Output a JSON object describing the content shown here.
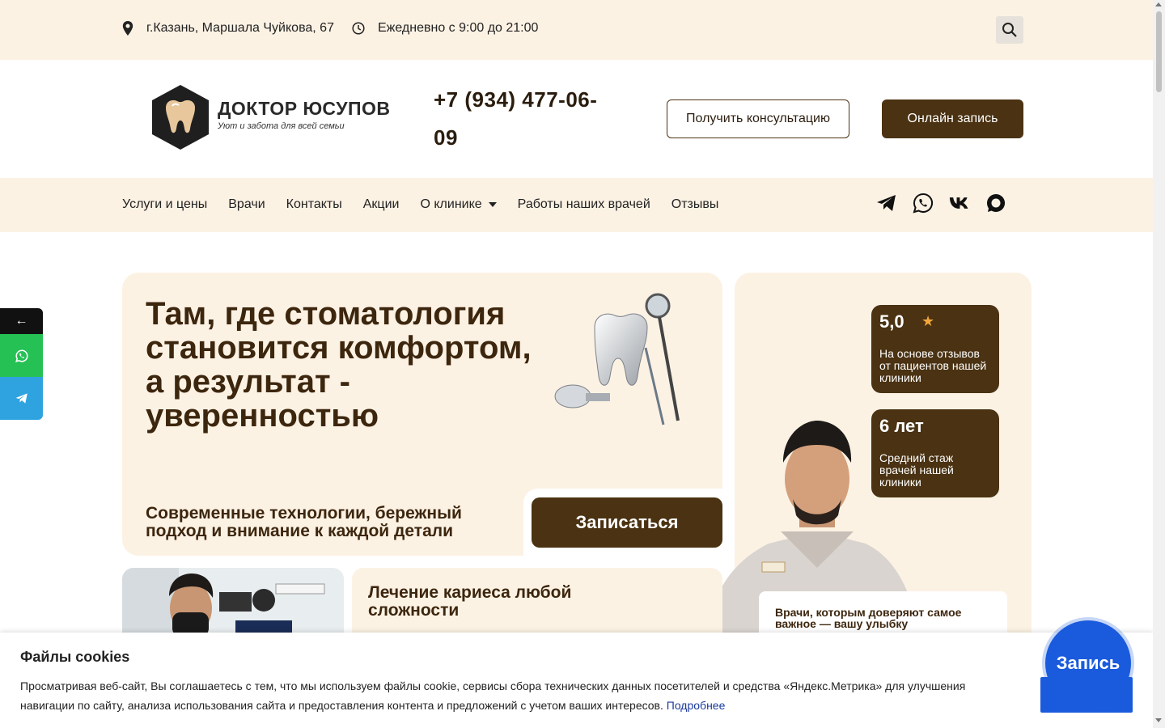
{
  "topbar": {
    "address": "г.Казань, Маршала Чуйкова, 67",
    "hours": "Ежедневно с 9:00 до 21:00",
    "icons": [
      "location-pin-icon",
      "clock-icon",
      "search-icon"
    ]
  },
  "header": {
    "logo_brand": "ДОКТОР ЮСУПОВ",
    "logo_tagline": "Уют и забота для всей семьи",
    "phone": "+7 (934) 477-06-09",
    "consult_button": "Получить консультацию",
    "online_button": "Онлайн запись"
  },
  "nav": {
    "items": [
      "Услуги и цены",
      "Врачи",
      "Контакты",
      "Акции",
      "О клинике",
      "Работы наших врачей",
      "Отзывы"
    ],
    "socials": [
      "telegram-icon",
      "whatsapp-icon",
      "vk-icon",
      "max-messenger-icon"
    ]
  },
  "hero": {
    "title": "Там, где стоматология становится комфортом, а результат - уверенностью",
    "subtitle": "Современные технологии, бережный подход и внимание к каждой детали",
    "book_button": "Записаться"
  },
  "stats": [
    {
      "value": "5,0",
      "text": "На основе отзывов от пациентов нашей клиники"
    },
    {
      "value": "6 лет",
      "text": "Средний стаж врачей нашей клиники"
    }
  ],
  "trust_card": "Врачи, которым доверяют самое важное — вашу улыбку",
  "caries_card": "Лечение кариеса любой сложности",
  "side_panel": {
    "back": "←"
  },
  "cookie": {
    "title": "Файлы cookies",
    "text": "Просматривая веб-сайт, Вы соглашаетесь с тем, что мы используем файлы cookie, сервисы сбора технических данных посетителей и средства «Яндекс.Метрика» для улучшения навигации по сайту, анализа использования сайта и предоставления контента и предложений с учетом ваших интересов.",
    "more_link": "Подробнее"
  },
  "zapis_button": "Запись",
  "colors": {
    "brand_brown": "#4a3212",
    "cream": "#fcf2e4",
    "accent_blue": "#1a5bdd",
    "whatsapp": "#25c154",
    "telegram": "#2fa3e0"
  }
}
